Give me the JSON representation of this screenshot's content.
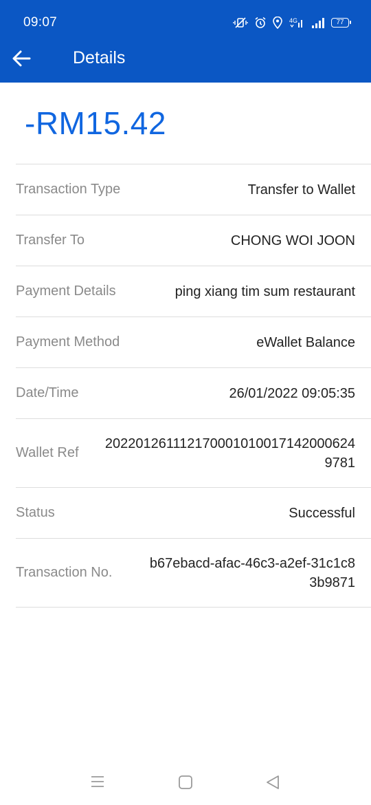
{
  "status_bar": {
    "time": "09:07",
    "battery": "77"
  },
  "header": {
    "title": "Details"
  },
  "amount": "-RM15.42",
  "details": [
    {
      "label": "Transaction Type",
      "value": "Transfer to Wallet"
    },
    {
      "label": "Transfer To",
      "value": "CHONG WOI JOON"
    },
    {
      "label": "Payment Details",
      "value": "ping xiang tim sum restaurant"
    },
    {
      "label": "Payment Method",
      "value": "eWallet Balance"
    },
    {
      "label": "Date/Time",
      "value": "26/01/2022 09:05:35"
    },
    {
      "label": "Wallet Ref",
      "value": "20220126111217000101001714200​06249781"
    },
    {
      "label": "Status",
      "value": "Successful"
    },
    {
      "label": "Transaction No.",
      "value": "b67ebacd-afac-46c3-a2ef-31c1c83b9871"
    }
  ],
  "icons": {
    "back": "arrow-left-icon",
    "mute": "vibrate-mute-icon",
    "alarm": "alarm-icon",
    "location": "location-icon",
    "network": "4g-icon",
    "signal": "signal-icon",
    "battery": "battery-icon",
    "nav_menu": "menu-icon",
    "nav_home": "home-square-icon",
    "nav_back": "back-triangle-icon"
  },
  "colors": {
    "appbar": "#0b57c4",
    "amount": "#1066e0",
    "label": "#8a8a8a",
    "divider": "#dddddd"
  }
}
